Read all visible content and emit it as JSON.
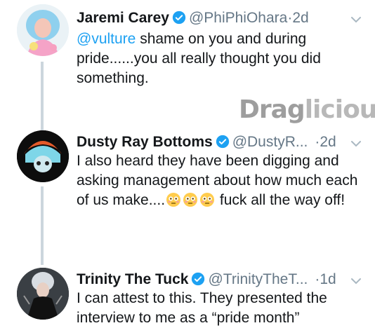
{
  "colors": {
    "link": "#1da1f2",
    "verified": "#1da1f2",
    "muted": "#657786",
    "thread_line": "#ccd6dd"
  },
  "watermark": {
    "part1": "Drag",
    "part2": "licious"
  },
  "tweets": [
    {
      "name": "Jaremi Carey",
      "handle": "@PhiPhiOhara",
      "sep": "·",
      "time": "2d",
      "mention": "@vulture",
      "text_after_mention": " shame on you and during pride......you all really thought you did something."
    },
    {
      "name": "Dusty Ray Bottoms",
      "handle": "@DustyR...",
      "sep": "·",
      "time": "2d",
      "text_before_emoji": "I also heard they have been digging and asking management about how much each of us make....",
      "emoji_icon": "flushed-face-icon",
      "text_after_emoji": " fuck all the way off!"
    },
    {
      "name": "Trinity The Tuck",
      "handle": "@TrinityTheT...",
      "sep": "·",
      "time": "1d",
      "text": "I can attest to this. They presented the interview to me as a “pride month”"
    }
  ]
}
